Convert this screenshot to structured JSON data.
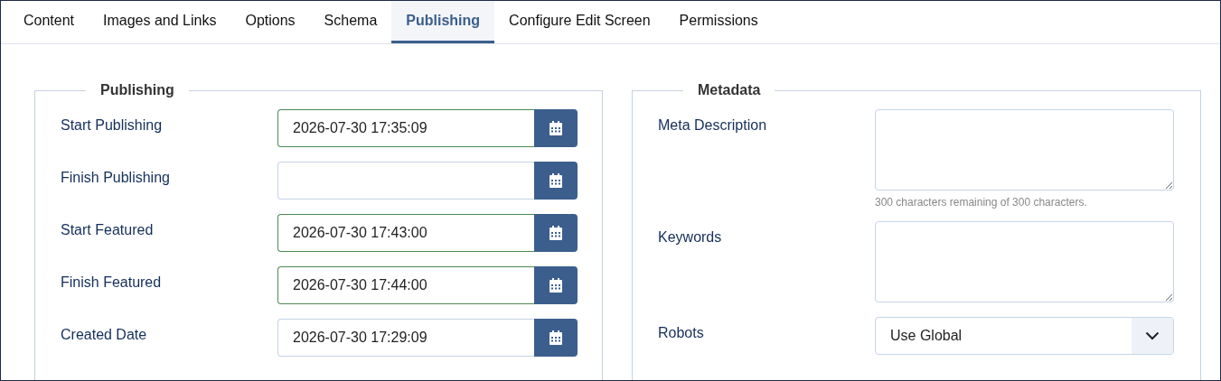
{
  "tabs": [
    {
      "label": "Content",
      "selected": false
    },
    {
      "label": "Images and Links",
      "selected": false
    },
    {
      "label": "Options",
      "selected": false
    },
    {
      "label": "Schema",
      "selected": false
    },
    {
      "label": "Publishing",
      "selected": true
    },
    {
      "label": "Configure Edit Screen",
      "selected": false
    },
    {
      "label": "Permissions",
      "selected": false
    }
  ],
  "publishing": {
    "legend": "Publishing",
    "fields": [
      {
        "label": "Start Publishing",
        "value": "2026-07-30 17:35:09",
        "valid": true
      },
      {
        "label": "Finish Publishing",
        "valid": false
      },
      {
        "label": "Start Featured",
        "value": "2026-07-30 17:43:00",
        "valid": true
      },
      {
        "label": "Finish Featured",
        "value": "2026-07-30 17:44:00",
        "valid": true
      },
      {
        "label": "Created Date",
        "value": "2026-07-30 17:29:09",
        "valid": false
      }
    ]
  },
  "metadata": {
    "legend": "Metadata",
    "fields": [
      {
        "kind": "textarea",
        "label": "Meta Description",
        "hint": "300 characters remaining of 300 characters."
      },
      {
        "kind": "textarea",
        "label": "Keywords"
      },
      {
        "kind": "select",
        "label": "Robots",
        "value": "Use Global"
      }
    ]
  }
}
